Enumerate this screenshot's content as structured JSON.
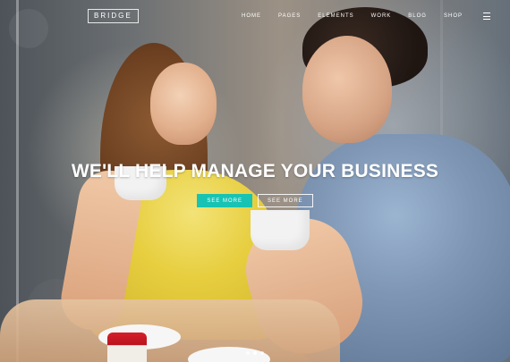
{
  "header": {
    "logo_text": "BRIDGE",
    "nav_items": [
      {
        "label": "HOME"
      },
      {
        "label": "PAGES"
      },
      {
        "label": "ELEMENTS"
      },
      {
        "label": "WORK"
      },
      {
        "label": "BLOG"
      },
      {
        "label": "SHOP"
      }
    ],
    "menu_icon": "hamburger-menu-icon"
  },
  "hero": {
    "title": "WE'LL HELP MANAGE YOUR BUSINESS",
    "buttons": [
      {
        "label": "SEE MORE",
        "style": "primary"
      },
      {
        "label": "SEE MORE",
        "style": "secondary"
      }
    ]
  },
  "slider": {
    "active_index": 1,
    "count": 3
  },
  "colors": {
    "accent": "#18c3b4",
    "text": "#ffffff"
  }
}
